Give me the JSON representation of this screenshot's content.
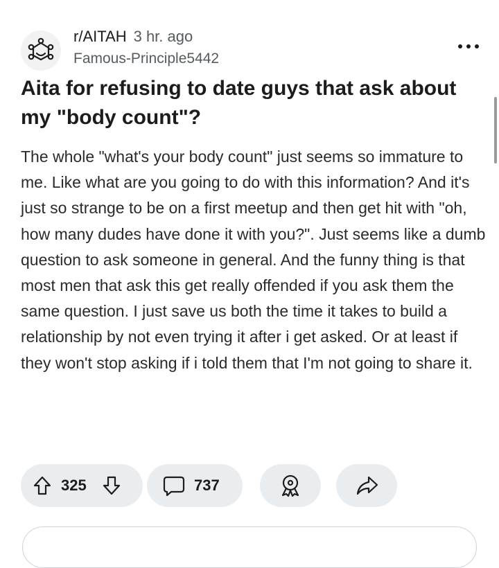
{
  "post": {
    "subreddit": "r/AITAH",
    "time_ago": "3 hr. ago",
    "author": "Famous-Principle5442",
    "title": "Aita for refusing to date guys that ask about my \"body count\"?",
    "body": "The whole \"what's your body count\" just seems so immature to me. Like what are you going to do with this information? And it's just so strange to be on a first meetup and then get hit with \"oh, how many dudes have done it with you?\". Just seems like a dumb question to ask someone in general. And the funny thing is that most men that ask this get really offended if you ask them the same question. I just save us both the time it takes to build a relationship by not even trying it after i get asked. Or at least if they won't stop asking if i told them that I'm not going to share it."
  },
  "actions": {
    "upvotes": "325",
    "comments": "737"
  },
  "icons": {
    "avatar": "subreddit-avatar-icon",
    "more": "more-options-icon",
    "upvote": "upvote-arrow-icon",
    "downvote": "downvote-arrow-icon",
    "comment": "comment-bubble-icon",
    "award": "award-icon",
    "share": "share-arrow-icon"
  },
  "colors": {
    "text": "#1c1c1c",
    "muted": "#555b5e",
    "pill_background": "#eaedef"
  }
}
